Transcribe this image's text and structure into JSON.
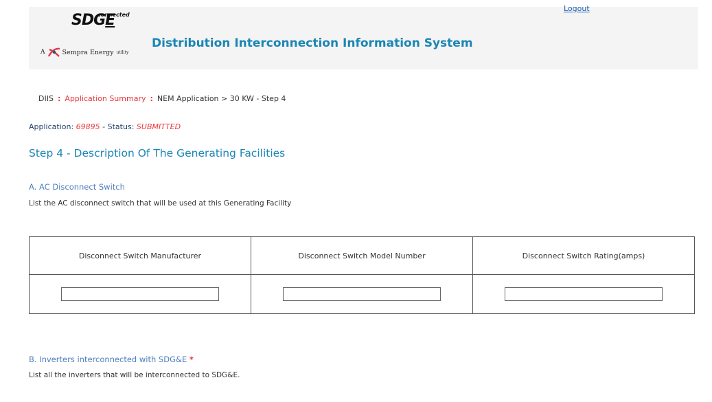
{
  "header": {
    "logout_label": "Logout",
    "logo_sdge": "SDG",
    "logo_e": "E",
    "logo_connected": "connected",
    "logo_tagline_a": "A",
    "logo_tagline": "Sempra Energy",
    "logo_tagline_small": "utility",
    "system_title": "Distribution Interconnection Information System"
  },
  "breadcrumb": {
    "items": [
      "DIIS",
      "Application Summary",
      "NEM Application > 30 KW - Step 4"
    ]
  },
  "application": {
    "label": "Application:",
    "number": "69895",
    "status_label": "- Status:",
    "status": "SUBMITTED"
  },
  "step_title": "Step 4 - Description Of The Generating Facilities",
  "section_a": {
    "title": "A. AC Disconnect Switch",
    "description": "List the AC disconnect switch that will be used at this Generating Facility",
    "columns": [
      "Disconnect Switch Manufacturer",
      "Disconnect Switch Model Number",
      "Disconnect Switch Rating(amps)"
    ],
    "values": [
      "",
      "",
      ""
    ]
  },
  "section_b": {
    "title": "B. Inverters interconnected with SDG&E",
    "required_mark": "*",
    "description": "List all the inverters that will be interconnected to SDG&E."
  },
  "colors": {
    "accent_blue": "#1a86b5",
    "link_red": "#e8383d",
    "section_blue": "#4d7fbf"
  }
}
